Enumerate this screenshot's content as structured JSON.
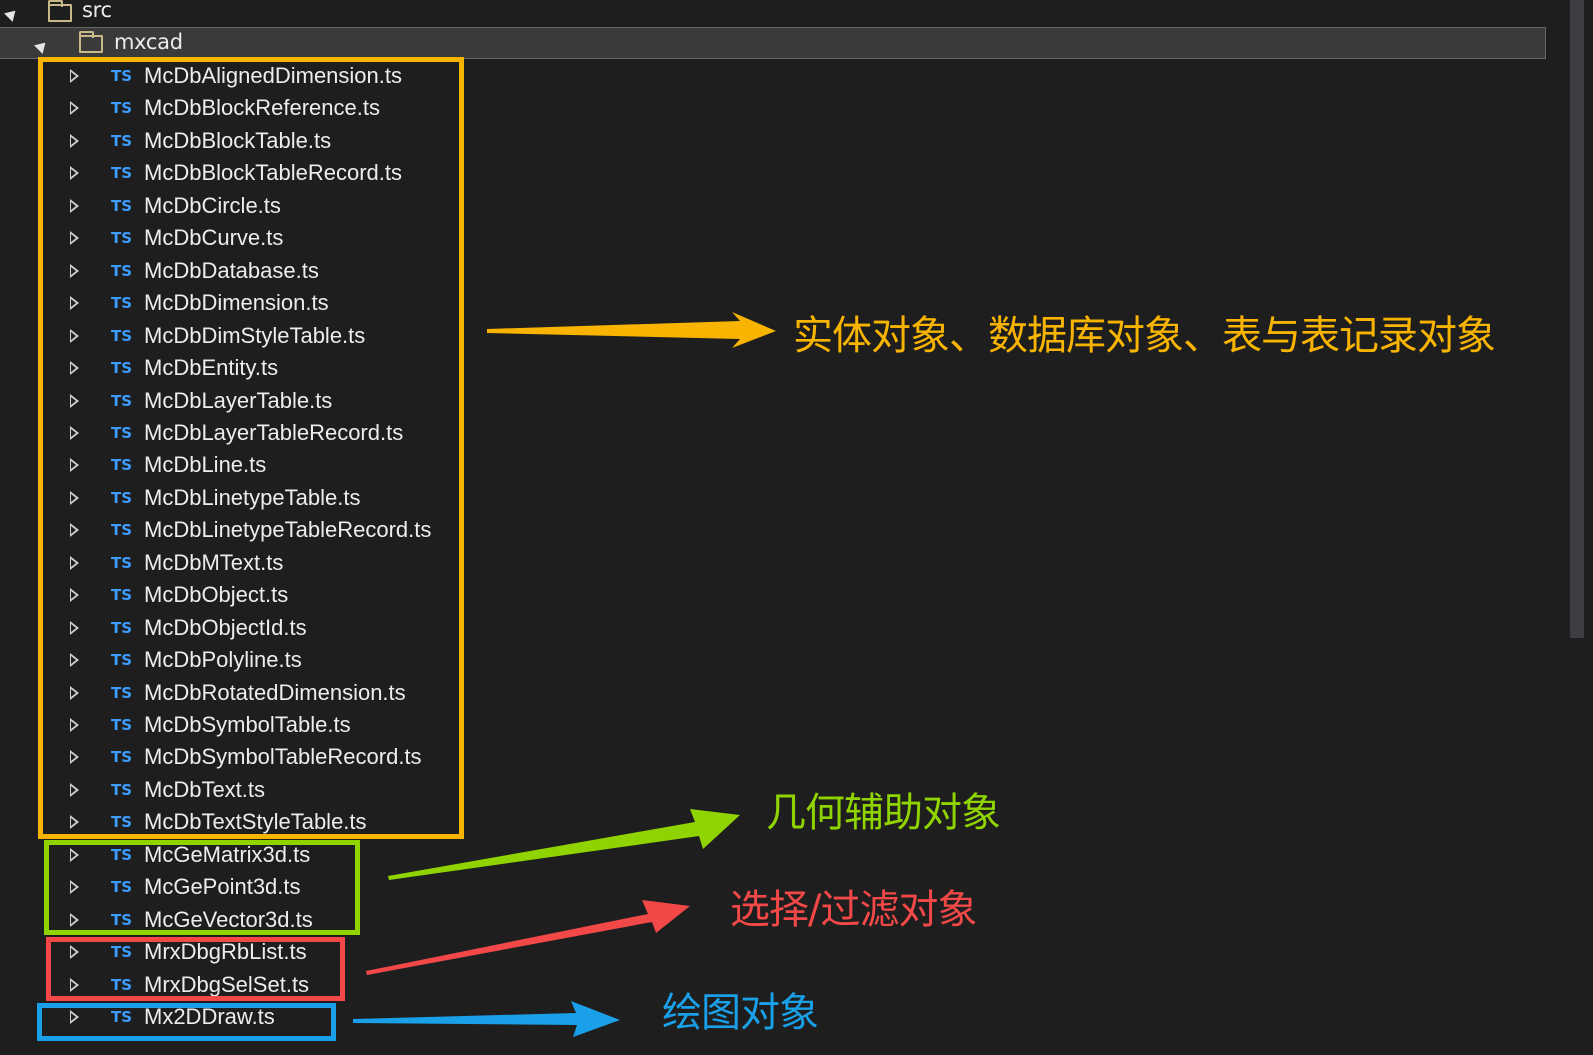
{
  "tree": {
    "root_folder": {
      "label": "src",
      "icon": "folder-icon",
      "expanded": true
    },
    "sub_folder": {
      "label": "mxcad",
      "icon": "folder-icon",
      "expanded": true,
      "selected": true
    },
    "file_icon_label": "TS",
    "files": [
      "McDbAlignedDimension.ts",
      "McDbBlockReference.ts",
      "McDbBlockTable.ts",
      "McDbBlockTableRecord.ts",
      "McDbCircle.ts",
      "McDbCurve.ts",
      "McDbDatabase.ts",
      "McDbDimension.ts",
      "McDbDimStyleTable.ts",
      "McDbEntity.ts",
      "McDbLayerTable.ts",
      "McDbLayerTableRecord.ts",
      "McDbLine.ts",
      "McDbLinetypeTable.ts",
      "McDbLinetypeTableRecord.ts",
      "McDbMText.ts",
      "McDbObject.ts",
      "McDbObjectId.ts",
      "McDbPolyline.ts",
      "McDbRotatedDimension.ts",
      "McDbSymbolTable.ts",
      "McDbSymbolTableRecord.ts",
      "McDbText.ts",
      "McDbTextStyleTable.ts",
      "McGeMatrix3d.ts",
      "McGePoint3d.ts",
      "McGeVector3d.ts",
      "MrxDbgRbList.ts",
      "MrxDbgSelSet.ts",
      "Mx2DDraw.ts"
    ]
  },
  "annotations": {
    "database_objects": {
      "text": "实体对象、数据库对象、表与表记录对象",
      "color": "#f8b400"
    },
    "geometry_helpers": {
      "text": "几何辅助对象",
      "color": "#8fd400"
    },
    "selection_filter": {
      "text": "选择/过滤对象",
      "color": "#f24848"
    },
    "drawing_objects": {
      "text": "绘图对象",
      "color": "#19a0e8"
    }
  },
  "colors": {
    "background": "#1e1e1e",
    "selected_row": "#3a3a3a",
    "ts_icon": "#3d9cff",
    "text": "#ededed"
  }
}
